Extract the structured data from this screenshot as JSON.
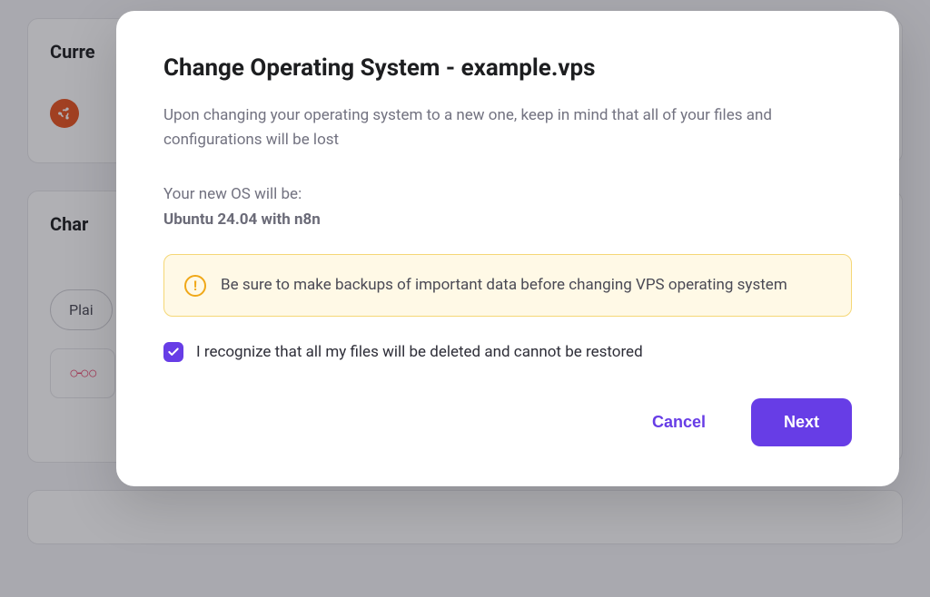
{
  "background": {
    "section1_title": "Curre",
    "section2_title": "Char",
    "tab_label": "Plai"
  },
  "modal": {
    "title": "Change Operating System - example.vps",
    "description": "Upon changing your operating system to a new one, keep in mind that all of your files and configurations will be lost",
    "new_os_label": "Your new OS will be:",
    "new_os_value": "Ubuntu 24.04 with n8n",
    "warning_text": "Be sure to make backups of important data before changing VPS operating system",
    "acknowledge_label": "I recognize that all my files will be deleted and cannot be restored",
    "acknowledge_checked": true,
    "cancel_label": "Cancel",
    "next_label": "Next"
  }
}
